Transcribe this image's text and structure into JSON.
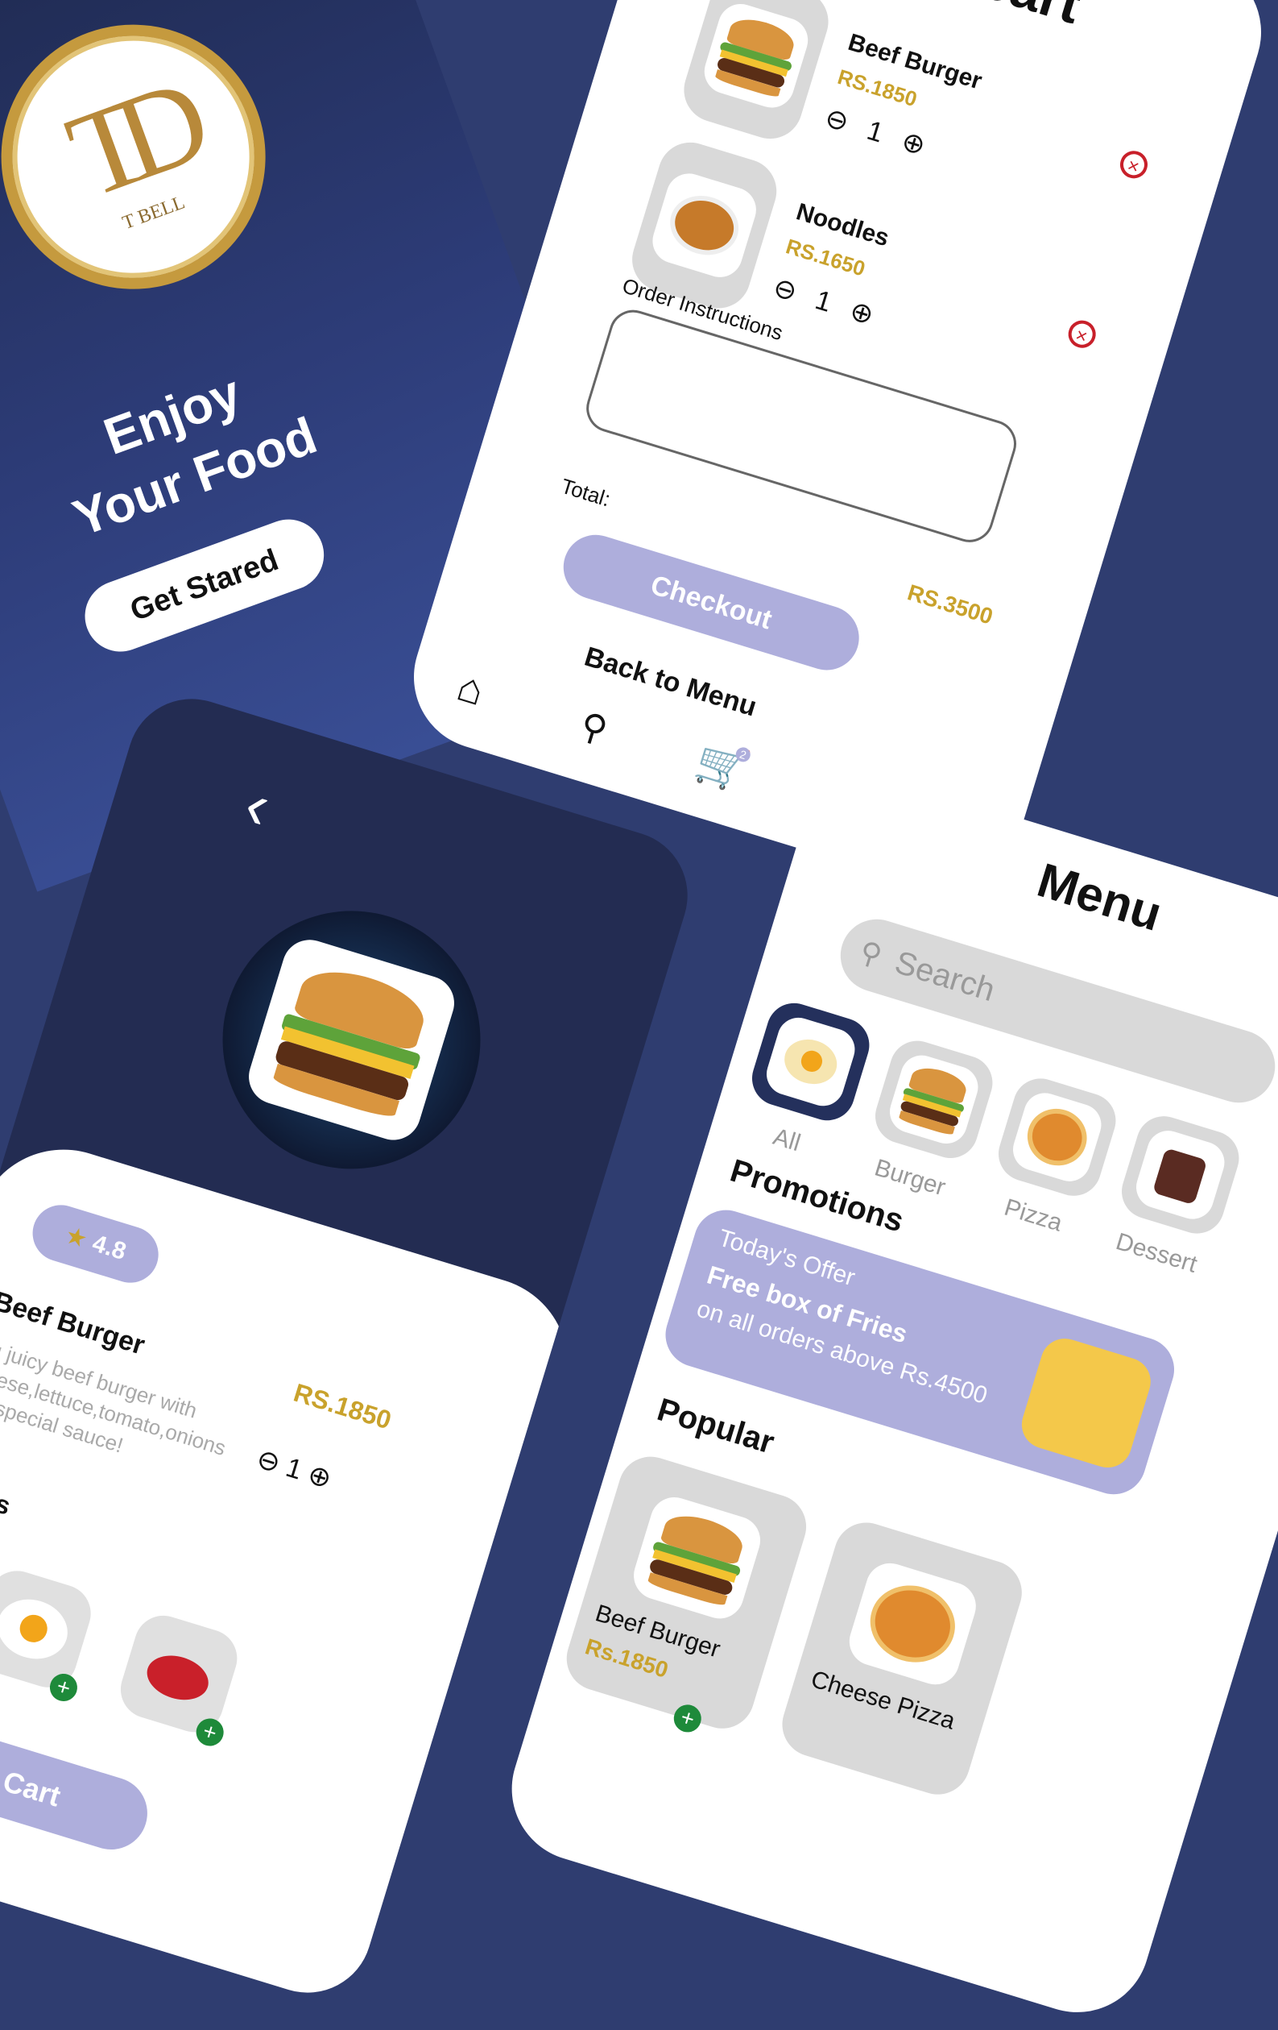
{
  "splash": {
    "logo_monogram": "TD",
    "logo_sub": "T BELL",
    "headline_line1": "Enjoy",
    "headline_line2": "Your Food",
    "cta": "Get Stared"
  },
  "cart": {
    "title": "Items in cart",
    "items": [
      {
        "name": "Beef Burger",
        "price": "RS.1850",
        "qty": "1"
      },
      {
        "name": "Noodles",
        "price": "RS.1650",
        "qty": "1"
      }
    ],
    "instructions_label": "Order Instructions",
    "instructions_value": "",
    "total_label": "Total:",
    "total_value": "RS.3500",
    "checkout": "Checkout",
    "back": "Back to Menu",
    "cart_badge": "2",
    "icons": {
      "home": "home-icon",
      "search": "search-icon",
      "cart": "cart-icon",
      "profile": "profile-icon"
    }
  },
  "detail": {
    "rating": "4.8",
    "name": "Beef Burger",
    "price": "RS.1850",
    "description": "Big juicy beef burger with cheese,lettuce,tomato,onions and special sauce!",
    "qty": "1",
    "addons_title": "Add Ons",
    "add_to_cart": "Add to Cart"
  },
  "menu": {
    "title": "Menu",
    "search_placeholder": "Search",
    "categories": [
      "All",
      "Burger",
      "Pizza",
      "Dessert"
    ],
    "promotions_title": "Promotions",
    "promo": {
      "line1": "Today's Offer",
      "line2": "Free box of Fries",
      "line3": "on all orders above Rs.4500"
    },
    "popular_title": "Popular",
    "popular": [
      {
        "name": "Beef Burger",
        "price": "Rs.1850"
      },
      {
        "name": "Cheese Pizza",
        "price": ""
      }
    ]
  },
  "colors": {
    "navy": "#2f3d70",
    "accent_lavender": "#aeaedc",
    "price_gold": "#c9a22c",
    "remove_red": "#c8202a",
    "add_green": "#1e8a3a"
  }
}
